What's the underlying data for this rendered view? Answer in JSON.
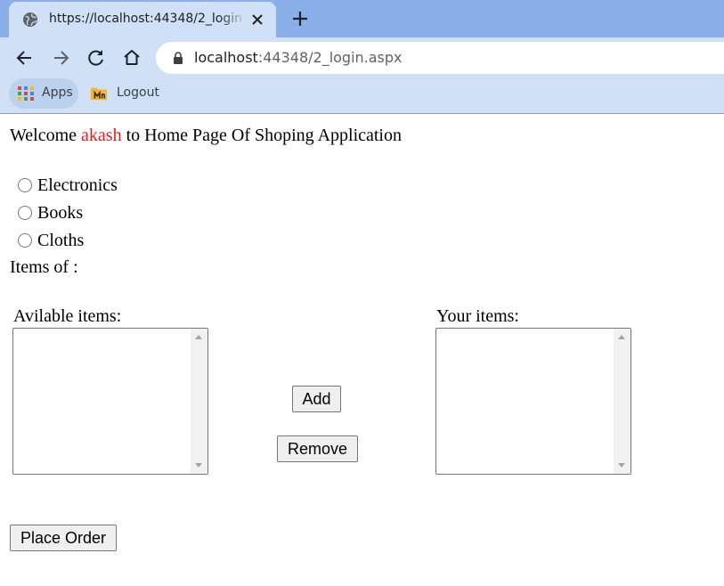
{
  "browser": {
    "tab": {
      "title": "https://localhost:44348/2_login.aspx"
    },
    "address": {
      "host": "localhost",
      "path": ":44348/2_login.aspx"
    },
    "bookmarks": [
      {
        "label": "Apps",
        "icon": "apps-grid-icon"
      },
      {
        "label": "Logout",
        "icon": "folder-bookmark-icon"
      }
    ]
  },
  "page": {
    "welcome": {
      "prefix": "Welcome ",
      "username": "akash",
      "suffix": " to Home Page Of Shoping Application"
    },
    "categories": [
      "Electronics",
      "Books",
      "Cloths"
    ],
    "items_of_label": "Items of :",
    "available_label": "Avilable items:",
    "your_items_label": "Your items:",
    "add_label": "Add",
    "remove_label": "Remove",
    "place_order_label": "Place Order"
  },
  "colors": {
    "username": "#e31b1b",
    "tabstrip": "#8aaee8",
    "toolbar": "#cfe0f7"
  }
}
